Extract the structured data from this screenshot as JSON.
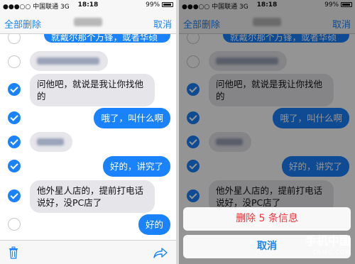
{
  "status": {
    "carrier": "中国联通",
    "network": "3G",
    "time": "18:18",
    "battery": "99%"
  },
  "nav": {
    "left": "全部删除",
    "right": "取消"
  },
  "messages": [
    {
      "dir": "out",
      "text": "就戴尔那个万锋，或者华硕",
      "checked": false
    },
    {
      "dir": "in",
      "text": "",
      "checked": false,
      "blurred": true
    },
    {
      "dir": "in",
      "text": "问他吧，就说是我让你找他的",
      "checked": true
    },
    {
      "dir": "out",
      "text": "哦了，叫什么啊",
      "checked": true
    },
    {
      "dir": "in",
      "text": "",
      "checked": true,
      "blurred": true
    },
    {
      "dir": "out",
      "text": "好的，讲究了",
      "checked": true
    },
    {
      "dir": "in",
      "text": "他外星人店的，提前打电话说好，没PC店了",
      "checked": true
    },
    {
      "dir": "out",
      "text": "好的",
      "checked": false
    }
  ],
  "action_sheet": {
    "delete": "删除 5 条信息",
    "cancel": "取消"
  },
  "watermark": {
    "main": "手机中国",
    "sub": "CNMO.COM"
  }
}
